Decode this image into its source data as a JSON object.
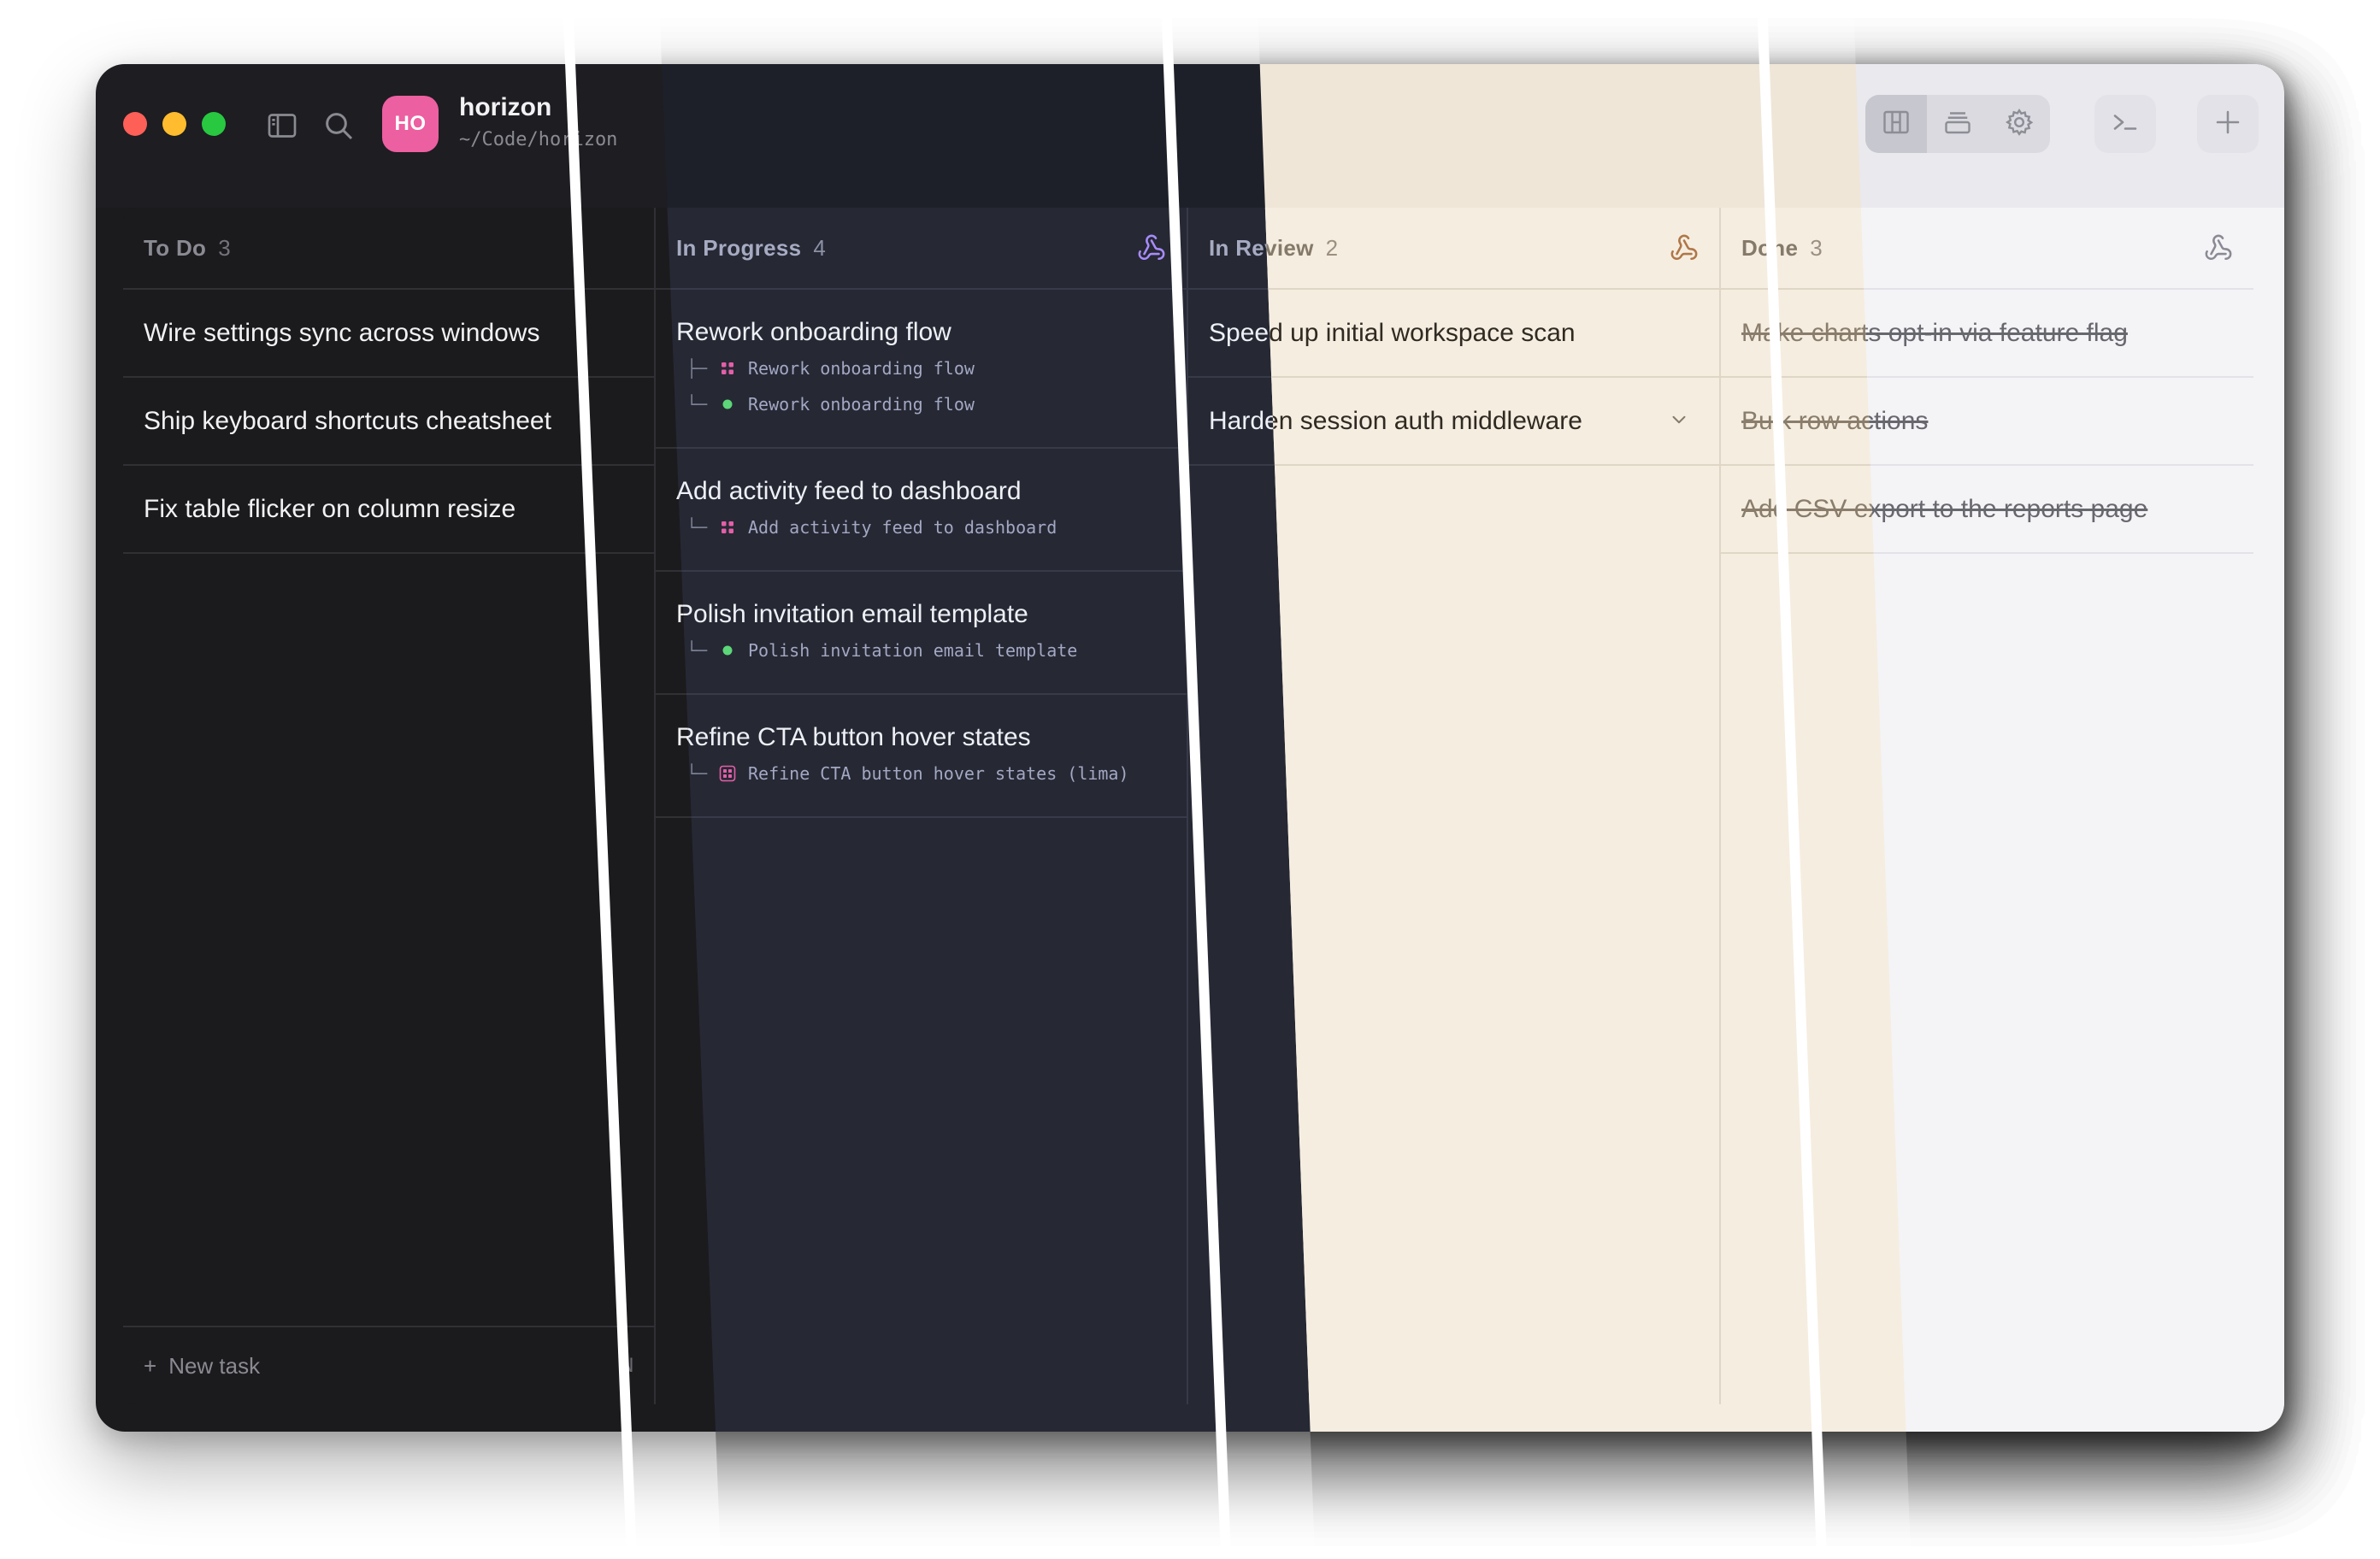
{
  "window": {
    "project_initials": "HO",
    "project_name": "horizon",
    "project_path": "~/Code/horizon"
  },
  "titlebar": {
    "icons": {
      "sidebar": "sidebar-toggle-icon",
      "search": "search-icon"
    },
    "view_tabs": [
      "kanban-board-icon",
      "stacked-list-icon",
      "gear-icon"
    ],
    "active_view": "kanban-board-icon",
    "terminal_button": "terminal-icon",
    "add_button": "plus-icon"
  },
  "columns": [
    {
      "title": "To Do",
      "count": "3",
      "webhook_icon": false,
      "cards": [
        {
          "title": "Wire settings sync across windows"
        },
        {
          "title": "Ship keyboard shortcuts cheatsheet"
        },
        {
          "title": "Fix table flicker on column resize"
        }
      ],
      "footer": {
        "label": "New task",
        "shortcut": "N"
      }
    },
    {
      "title": "In Progress",
      "count": "4",
      "webhook_icon": true,
      "cards": [
        {
          "title": "Rework onboarding flow",
          "subs": [
            {
              "branch": "├─",
              "icon": "grid-icon",
              "text": "Rework onboarding flow"
            },
            {
              "branch": "└─",
              "icon": "status-dot-icon",
              "text": "Rework onboarding flow"
            }
          ]
        },
        {
          "title": "Add activity feed to dashboard",
          "subs": [
            {
              "branch": "└─",
              "icon": "grid-icon",
              "text": "Add activity feed to dashboard"
            }
          ]
        },
        {
          "title": "Polish invitation email template",
          "subs": [
            {
              "branch": "└─",
              "icon": "status-dot-icon",
              "text": "Polish invitation email template"
            }
          ]
        },
        {
          "title": "Refine CTA button hover states",
          "subs": [
            {
              "branch": "└─",
              "icon": "boxed-grid-icon",
              "text": "Refine CTA button hover states (lima)"
            }
          ]
        }
      ]
    },
    {
      "title": "In Review",
      "count": "2",
      "webhook_icon": true,
      "cards": [
        {
          "title": "Speed up initial workspace scan"
        },
        {
          "title": "Harden session auth middleware",
          "expand_icon": "chevron-down-icon"
        }
      ]
    },
    {
      "title": "Done",
      "count": "3",
      "webhook_icon": true,
      "cards": [
        {
          "title": "Make charts opt-in via feature flag"
        },
        {
          "title": "Bulk row actions"
        },
        {
          "title": "Add CSV export to the reports page"
        }
      ]
    }
  ],
  "colors": {
    "traffic_red": "#fe5f57",
    "traffic_yellow": "#febc2e",
    "traffic_green": "#28c840",
    "avatar": "#ec5fa0",
    "accent_pink": "#e35fa8",
    "accent_green": "#5cd679"
  },
  "themes": [
    "Dark",
    "Midnight",
    "Sand",
    "Light"
  ]
}
